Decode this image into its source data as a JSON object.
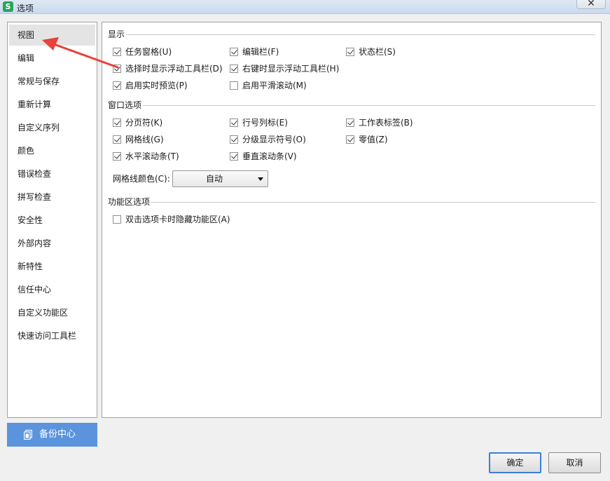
{
  "window": {
    "title": "选项",
    "app_icon": "S",
    "close": "✕"
  },
  "sidebar": {
    "items": [
      {
        "label": "视图",
        "active": true
      },
      {
        "label": "编辑"
      },
      {
        "label": "常规与保存"
      },
      {
        "label": "重新计算"
      },
      {
        "label": "自定义序列"
      },
      {
        "label": "颜色"
      },
      {
        "label": "错误检查"
      },
      {
        "label": "拼写检查"
      },
      {
        "label": "安全性"
      },
      {
        "label": "外部内容"
      },
      {
        "label": "新特性"
      },
      {
        "label": "信任中心"
      },
      {
        "label": "自定义功能区"
      },
      {
        "label": "快速访问工具栏"
      }
    ],
    "backup_label": "备份中心"
  },
  "display": {
    "title": "显示",
    "options": [
      {
        "label": "任务窗格(U)",
        "checked": true
      },
      {
        "label": "编辑栏(F)",
        "checked": true
      },
      {
        "label": "状态栏(S)",
        "checked": true
      },
      {
        "label": "选择时显示浮动工具栏(D)",
        "checked": true
      },
      {
        "label": "右键时显示浮动工具栏(H)",
        "checked": true
      },
      {
        "label": "启用实时预览(P)",
        "checked": true
      },
      {
        "label": "启用平滑滚动(M)",
        "checked": false
      }
    ]
  },
  "window_options": {
    "title": "窗口选项",
    "options": [
      {
        "label": "分页符(K)",
        "checked": true
      },
      {
        "label": "行号列标(E)",
        "checked": true
      },
      {
        "label": "工作表标签(B)",
        "checked": true
      },
      {
        "label": "网格线(G)",
        "checked": true
      },
      {
        "label": "分级显示符号(O)",
        "checked": true
      },
      {
        "label": "零值(Z)",
        "checked": true
      },
      {
        "label": "水平滚动条(T)",
        "checked": true
      },
      {
        "label": "垂直滚动条(V)",
        "checked": true
      }
    ],
    "grid_color_label": "网格线颜色(C):",
    "grid_color_value": "自动"
  },
  "ribbon_options": {
    "title": "功能区选项",
    "options": [
      {
        "label": "双击选项卡时隐藏功能区(A)",
        "checked": false
      }
    ]
  },
  "buttons": {
    "ok": "确定",
    "cancel": "取消"
  },
  "colors": {
    "accent": "#5b94dc",
    "annotation_arrow": "#e8423a"
  }
}
